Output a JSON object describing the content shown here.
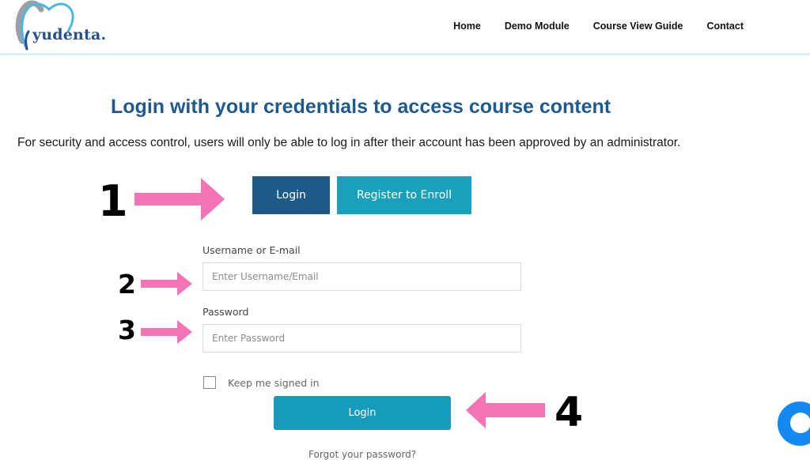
{
  "brand": {
    "name": "yudenta.",
    "logo_icon": "tooth-icon",
    "colors": {
      "logo_text": "#27508f",
      "logo_swoosh": "#4bb8e0",
      "logo_grey": "#9aa0a6"
    }
  },
  "nav": {
    "items": [
      {
        "label": "Home"
      },
      {
        "label": "Demo Module"
      },
      {
        "label": "Course View Guide"
      },
      {
        "label": "Contact"
      }
    ]
  },
  "main": {
    "title": "Login with your credentials to access course content",
    "subtitle": "For security and access control, users will only be able to log in after their account has been approved by an administrator.",
    "tabs": [
      {
        "label": "Login",
        "active": true,
        "color": "#1d5a87"
      },
      {
        "label": "Register to Enroll",
        "active": false,
        "color": "#1aa0bb"
      }
    ]
  },
  "form": {
    "username_label": "Username or E-mail",
    "username_placeholder": "Enter Username/Email",
    "username_value": "",
    "password_label": "Password",
    "password_placeholder": "Enter Password",
    "password_value": "",
    "keep_signed_in_label": "Keep me signed in",
    "keep_signed_in_checked": false,
    "submit_label": "Login",
    "submit_color": "#169bbb",
    "forgot_label": "Forgot your password?"
  },
  "annotations": {
    "steps": [
      "1",
      "2",
      "3",
      "4"
    ],
    "arrow_color": "#f472b6"
  },
  "chat": {
    "icon": "chat-bubble-icon",
    "color": "#1389f2"
  }
}
